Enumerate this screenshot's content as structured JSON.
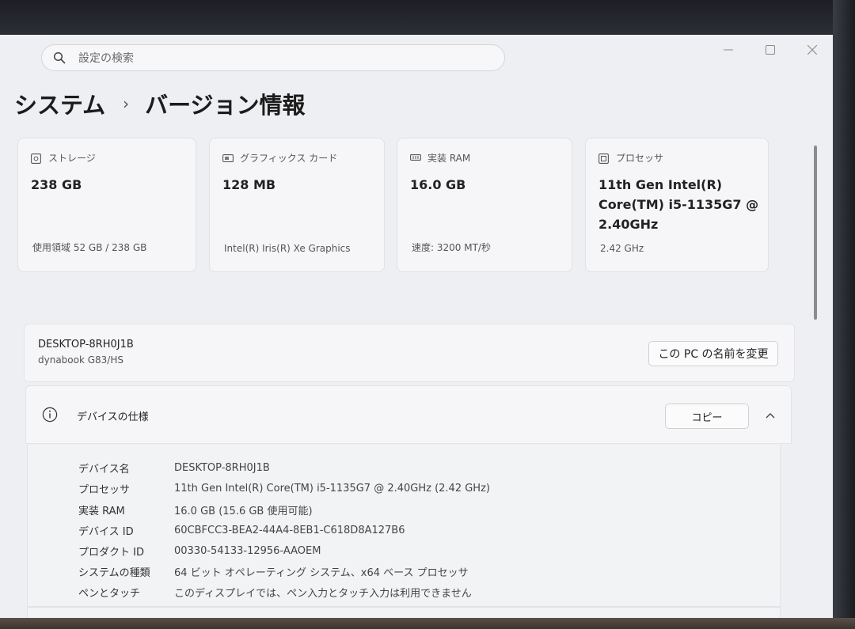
{
  "search": {
    "placeholder": "設定の検索"
  },
  "breadcrumb": {
    "parent": "システム",
    "separator": "›",
    "current": "バージョン情報"
  },
  "cards": [
    {
      "icon": "storage-icon",
      "label": "ストレージ",
      "value": "238 GB",
      "sub": "使用領域 52 GB / 238 GB"
    },
    {
      "icon": "graphics-card-icon",
      "label": "グラフィックス カード",
      "value": "128 MB",
      "sub": "Intel(R) Iris(R) Xe Graphics"
    },
    {
      "icon": "ram-icon",
      "label": "実装 RAM",
      "value": "16.0 GB",
      "sub": "速度: 3200 MT/秒"
    },
    {
      "icon": "processor-icon",
      "label": "プロセッサ",
      "value_lines": [
        "11th Gen Intel(R)",
        "Core(TM) i5-1135G7 @",
        "2.40GHz"
      ],
      "sub": "2.42 GHz"
    }
  ],
  "device": {
    "name": "DESKTOP-8RH0J1B",
    "model": "dynabook G83/HS",
    "rename_label": "この PC の名前を変更"
  },
  "specs": {
    "title": "デバイスの仕様",
    "copy_label": "コピー",
    "rows": [
      {
        "key": "デバイス名",
        "value": "DESKTOP-8RH0J1B"
      },
      {
        "key": "プロセッサ",
        "value": "11th Gen Intel(R) Core(TM) i5-1135G7 @ 2.40GHz (2.42 GHz)"
      },
      {
        "key": "実装 RAM",
        "value": "16.0 GB (15.6 GB 使用可能)"
      },
      {
        "key": "デバイス ID",
        "value": "60CBFCC3-BEA2-44A4-8EB1-C618D8A127B6"
      },
      {
        "key": "プロダクト ID",
        "value": "00330-54133-12956-AAOEM"
      },
      {
        "key": "システムの種類",
        "value": "64 ビット オペレーティング システム、x64 ベース プロセッサ"
      },
      {
        "key": "ペンとタッチ",
        "value": "このディスプレイでは、ペン入力とタッチ入力は利用できません"
      }
    ]
  }
}
